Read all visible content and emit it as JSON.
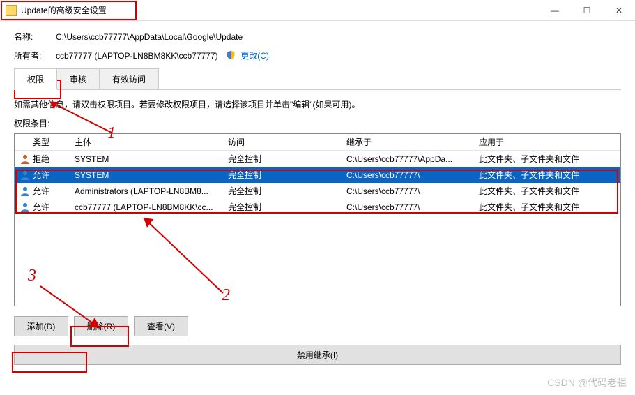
{
  "window": {
    "title": "Update的高级安全设置",
    "min": "—",
    "max": "☐",
    "close": "✕"
  },
  "name_label": "名称:",
  "name_value": "C:\\Users\\ccb77777\\AppData\\Local\\Google\\Update",
  "owner_label": "所有者:",
  "owner_value": "ccb77777 (LAPTOP-LN8BM8KK\\ccb77777)",
  "change_link": "更改(C)",
  "tabs": {
    "perm": "权限",
    "audit": "审核",
    "effective": "有效访问"
  },
  "help_text": "如需其他信息，请双击权限项目。若要修改权限项目，请选择该项目并单击\"编辑\"(如果可用)。",
  "entries_label": "权限条目:",
  "columns": {
    "type": "类型",
    "principal": "主体",
    "access": "访问",
    "inherit": "继承于",
    "applies": "应用于"
  },
  "rows": [
    {
      "type": "拒绝",
      "principal": "SYSTEM",
      "access": "完全控制",
      "inherit": "C:\\Users\\ccb77777\\AppDa...",
      "applies": "此文件夹、子文件夹和文件",
      "selected": false
    },
    {
      "type": "允许",
      "principal": "SYSTEM",
      "access": "完全控制",
      "inherit": "C:\\Users\\ccb77777\\",
      "applies": "此文件夹、子文件夹和文件",
      "selected": true
    },
    {
      "type": "允许",
      "principal": "Administrators (LAPTOP-LN8BM8...",
      "access": "完全控制",
      "inherit": "C:\\Users\\ccb77777\\",
      "applies": "此文件夹、子文件夹和文件",
      "selected": false
    },
    {
      "type": "允许",
      "principal": "ccb77777 (LAPTOP-LN8BM8KK\\cc...",
      "access": "完全控制",
      "inherit": "C:\\Users\\ccb77777\\",
      "applies": "此文件夹、子文件夹和文件",
      "selected": false
    }
  ],
  "buttons": {
    "add": "添加(D)",
    "remove": "删除(R)",
    "view": "查看(V)",
    "disable_inherit": "禁用继承(I)"
  },
  "annotations": {
    "n1": "1",
    "n2": "2",
    "n3": "3"
  },
  "watermark": "CSDN @代码老祖"
}
